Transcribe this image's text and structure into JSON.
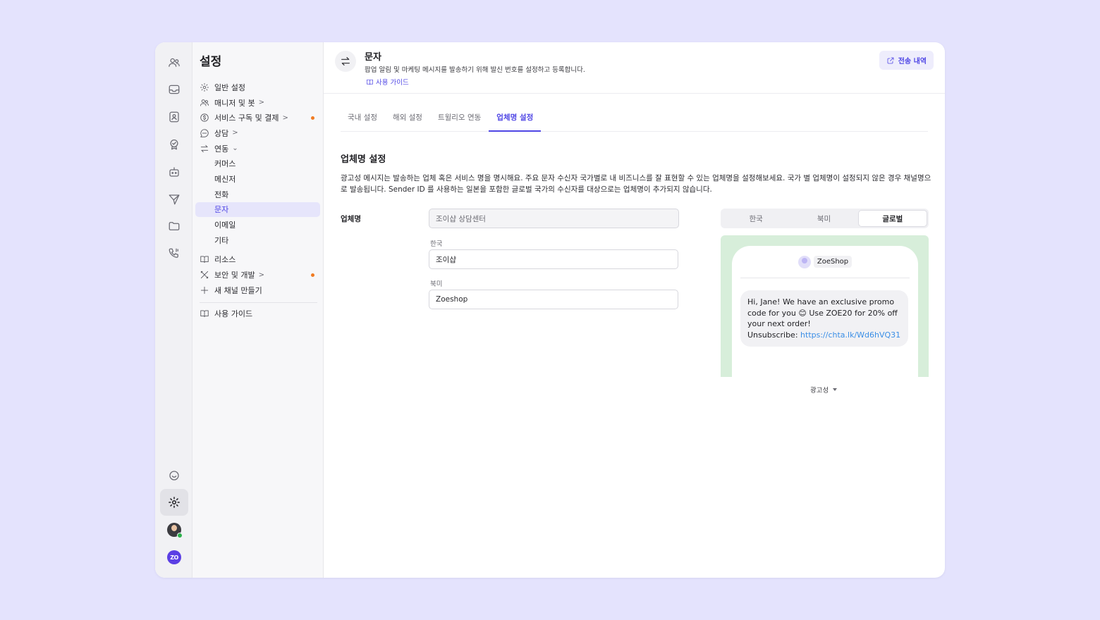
{
  "sidebar": {
    "title": "설정",
    "items": [
      {
        "label": "일반 설정"
      },
      {
        "label": "매니저 및 봇"
      },
      {
        "label": "서비스 구독 및 결제"
      },
      {
        "label": "상담"
      },
      {
        "label": "연동"
      },
      {
        "label": "커머스"
      },
      {
        "label": "메신저"
      },
      {
        "label": "전화"
      },
      {
        "label": "문자"
      },
      {
        "label": "이메일"
      },
      {
        "label": "기타"
      },
      {
        "label": "리소스"
      },
      {
        "label": "보안 및 개발"
      },
      {
        "label": "새 채널 만들기"
      },
      {
        "label": "사용 가이드"
      }
    ]
  },
  "rail": {
    "logo_text": "ZO"
  },
  "header": {
    "title": "문자",
    "description": "팝업 알림 및 마케팅 메시지를 발송하기 위해 발신 번호를 설정하고 등록합니다.",
    "guide_link": "사용 가이드",
    "history_button": "전송 내역"
  },
  "tabs": [
    {
      "label": "국내 설정"
    },
    {
      "label": "해외 설정"
    },
    {
      "label": "트윌리오 연동"
    },
    {
      "label": "업체명 설정"
    }
  ],
  "section": {
    "title": "업체명 설정",
    "description": "광고성 메시지는 발송하는 업체 혹은 서비스 명을 명시해요. 주요 문자 수신자 국가별로 내 비즈니스를 잘 표현할 수 있는 업체명을 설정해보세요. 국가 별 업체명이 설정되지 않은 경우 채널명으로 발송됩니다. Sender ID 를 사용하는 일본을 포함한 글로벌 국가의 수신자를 대상으로는 업체명이 추가되지 않습니다."
  },
  "form": {
    "label": "업체명",
    "default_value": "조이샵 상담센터",
    "korea_label": "한국",
    "korea_value": "조이샵",
    "na_label": "북미",
    "na_value": "Zoeshop"
  },
  "preview": {
    "regions": [
      {
        "label": "한국"
      },
      {
        "label": "북미"
      },
      {
        "label": "글로벌"
      }
    ],
    "sender": "ZoeShop",
    "message_text": "Hi, Jane! We have an exclusive promo code for you 😊 Use ZOE20 for 20% off your next order!",
    "unsubscribe_label": "Unsubscribe:",
    "unsubscribe_link": "https://chta.lk/Wd6hVQ31",
    "message_type": "광고성"
  },
  "colors": {
    "accent": "#4f46e5",
    "background": "#e4e3fd",
    "preview_bg": "#d7eeda",
    "notification_dot": "#f07b22",
    "link": "#3a8ee6"
  }
}
